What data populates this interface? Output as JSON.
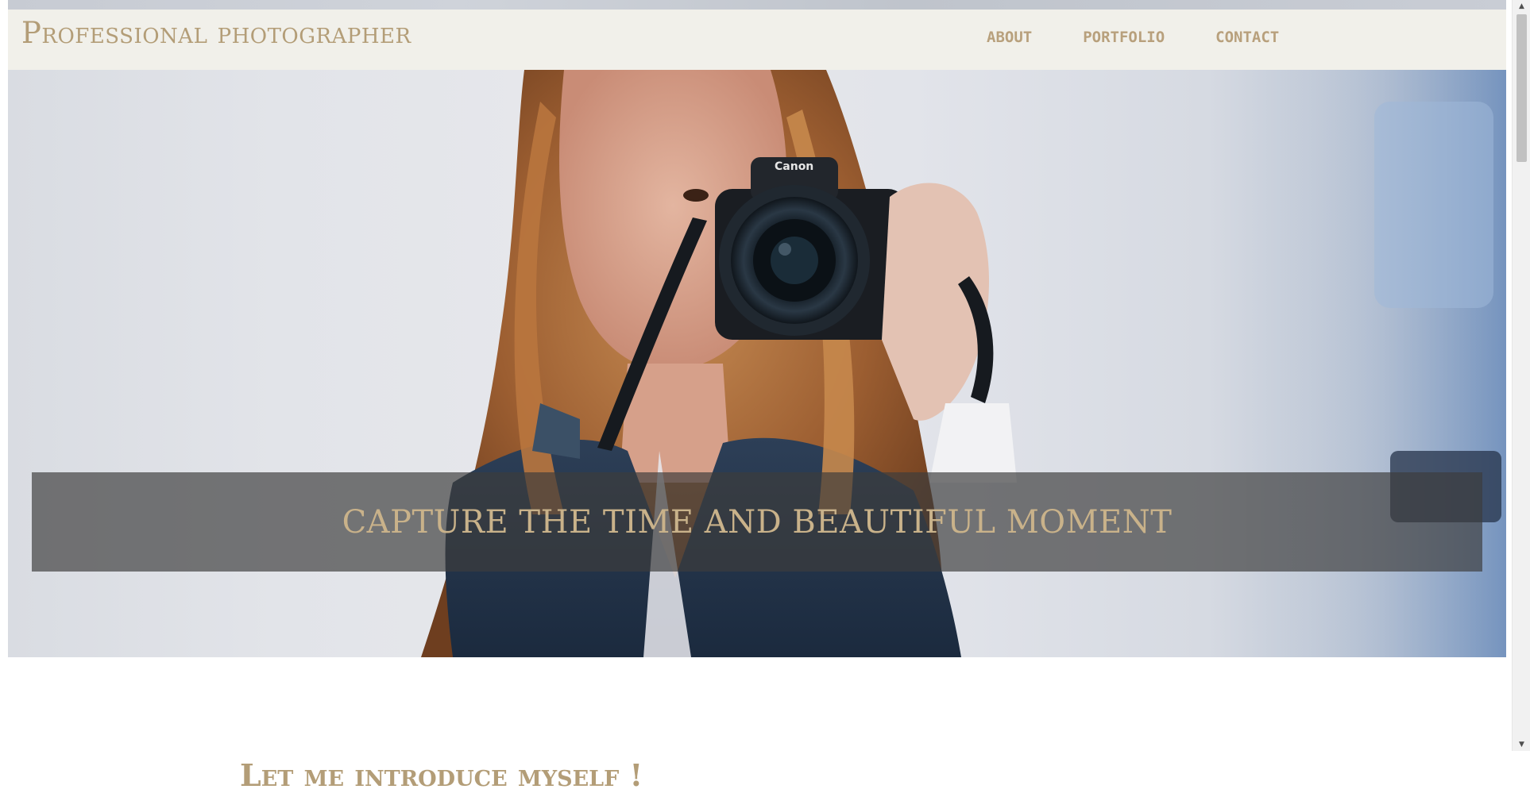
{
  "header": {
    "brand": "Professional photographer",
    "nav": [
      {
        "label": "ABOUT"
      },
      {
        "label": "PORTFOLIO"
      },
      {
        "label": "CONTACT"
      }
    ]
  },
  "hero": {
    "caption": "CAPTURE THE TIME AND BEAUTIFUL MOMENT",
    "image_description_icon": "woman-with-camera-photo"
  },
  "intro": {
    "title": "Let me introduce myself !"
  },
  "scrollbar": {
    "up_icon": "▲",
    "down_icon": "▼"
  },
  "colors": {
    "accent": "#b39d77",
    "header_bg": "#f1f0ea",
    "caption_band": "#3c3c3c"
  }
}
